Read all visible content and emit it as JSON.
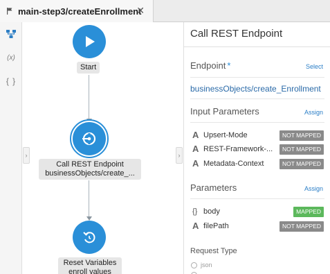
{
  "tab": {
    "title": "main-step3/createEnrollment",
    "close_glyph": "✕"
  },
  "toolbar": {
    "x_label": "(x)",
    "brace_label": "{ }",
    "handle_left": "›",
    "handle_right": "›"
  },
  "flow": {
    "nodes": [
      {
        "label": "Start",
        "icon": "play-icon"
      },
      {
        "label_line1": "Call REST Endpoint",
        "label_line2": "businessObjects/create_...",
        "icon": "rest-endpoint-icon",
        "selected": true
      },
      {
        "label_line1": "Reset Variables",
        "label_line2": "enroll values",
        "icon": "reset-icon"
      }
    ]
  },
  "panel": {
    "title": "Call REST Endpoint",
    "endpoint": {
      "label": "Endpoint",
      "required_marker": "*",
      "action": "Select",
      "value": "businessObjects/create_Enrollment"
    },
    "input_parameters": {
      "label": "Input Parameters",
      "action": "Assign",
      "items": [
        {
          "type_glyph": "A",
          "name": "Upsert-Mode",
          "status": "NOT MAPPED"
        },
        {
          "type_glyph": "A",
          "name": "REST-Framework-...",
          "status": "NOT MAPPED"
        },
        {
          "type_glyph": "A",
          "name": "Metadata-Context",
          "status": "NOT MAPPED"
        }
      ]
    },
    "parameters": {
      "label": "Parameters",
      "action": "Assign",
      "items": [
        {
          "type_glyph": "{}",
          "name": "body",
          "status": "MAPPED"
        },
        {
          "type_glyph": "A",
          "name": "filePath",
          "status": "NOT MAPPED"
        }
      ]
    },
    "request_type": {
      "label": "Request Type",
      "option_partial": "json"
    }
  },
  "colors": {
    "accent": "#2a8fd8",
    "mapped": "#5cb85c",
    "not_mapped": "#8a8a8a"
  }
}
